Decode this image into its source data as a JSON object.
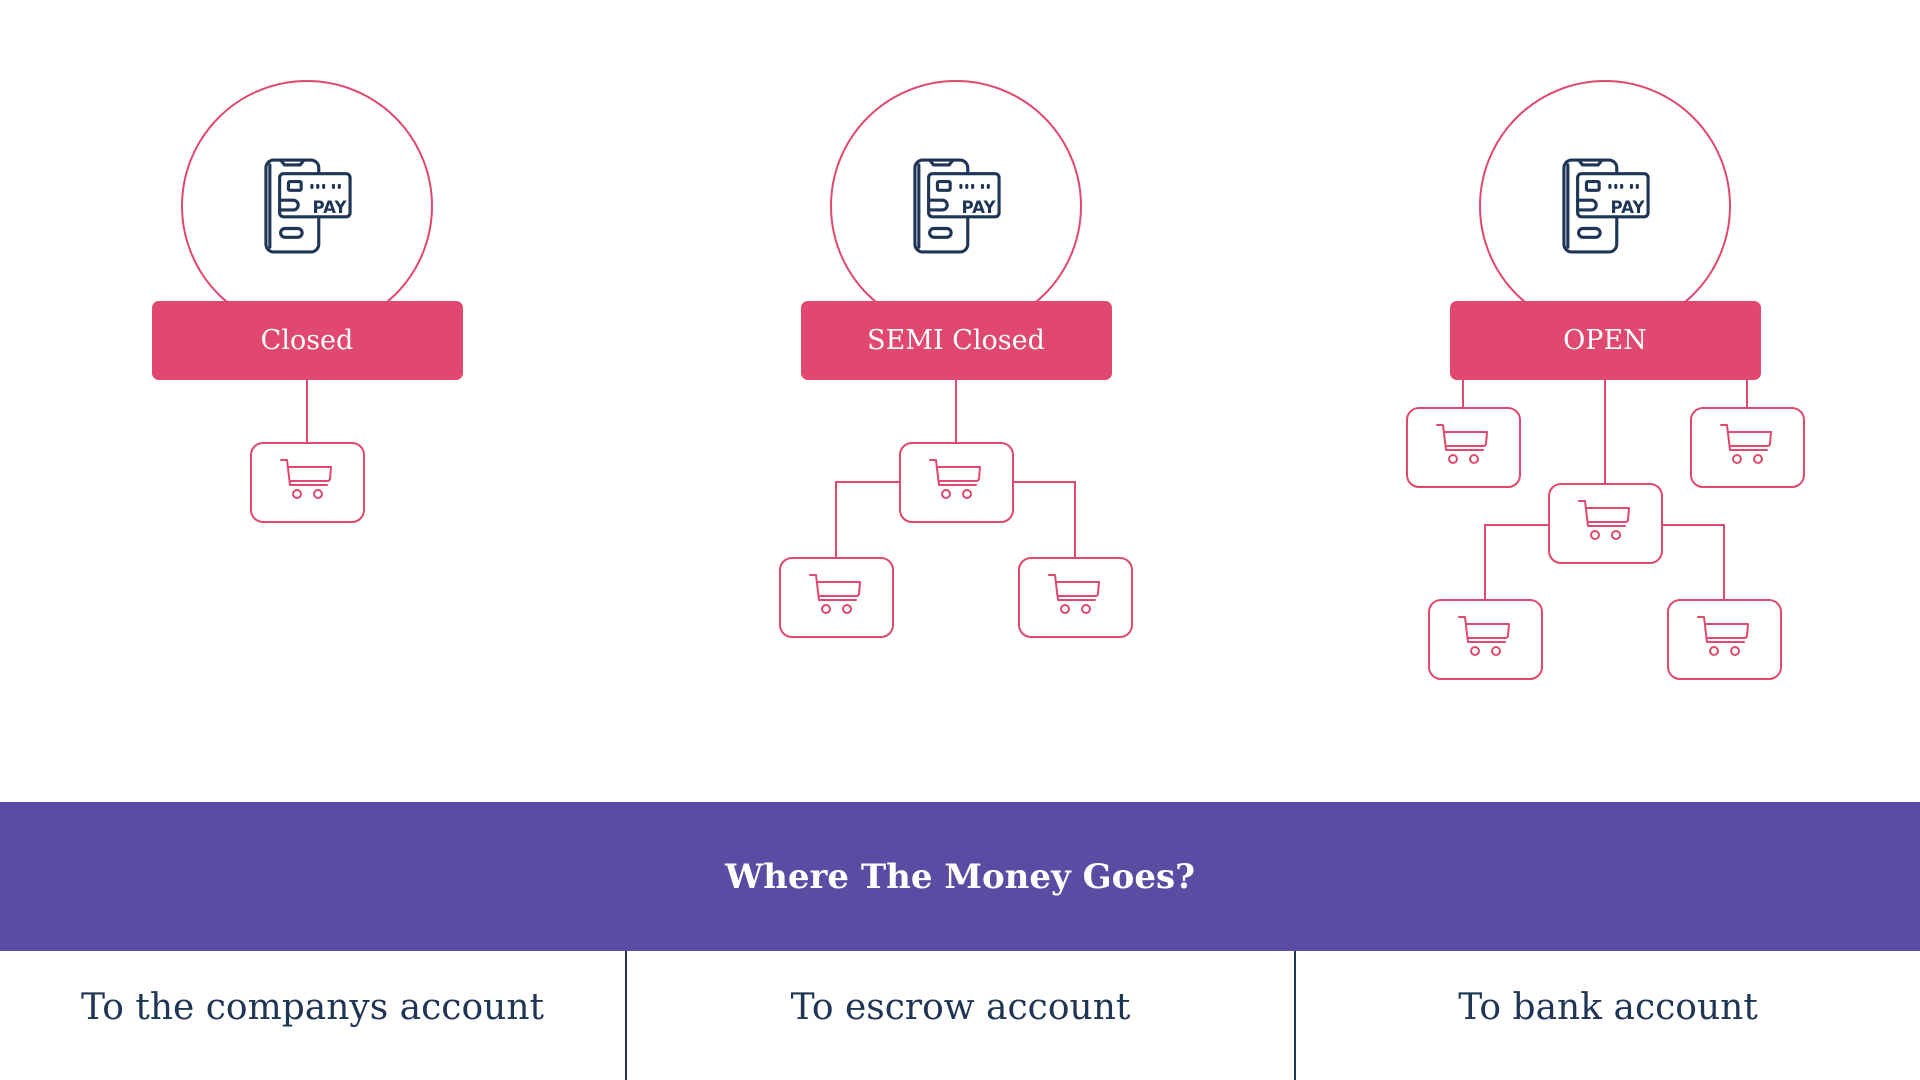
{
  "colors": {
    "accent": "#e0486f",
    "icon_ink": "#1f3556",
    "banner": "#5b4ca3",
    "text": "#1f3556"
  },
  "models": [
    {
      "id": "closed",
      "label": "Closed",
      "icon": "mobile-pay-icon",
      "merchants": 1,
      "structure": "single merchant"
    },
    {
      "id": "semi-closed",
      "label": "SEMI Closed",
      "icon": "mobile-pay-icon",
      "merchants": 3,
      "structure": "one merchant with two branches"
    },
    {
      "id": "open",
      "label": "OPEN",
      "icon": "mobile-pay-icon",
      "merchants": 5,
      "structure": "three direct merchants, middle one with two branches"
    }
  ],
  "pay_icon_text": "PAY",
  "merchant_icon": "shopping-cart-icon",
  "banner": {
    "title": "Where The Money Goes?"
  },
  "destinations": [
    {
      "label": "To the companys account"
    },
    {
      "label": "To escrow account"
    },
    {
      "label": "To bank account"
    }
  ]
}
